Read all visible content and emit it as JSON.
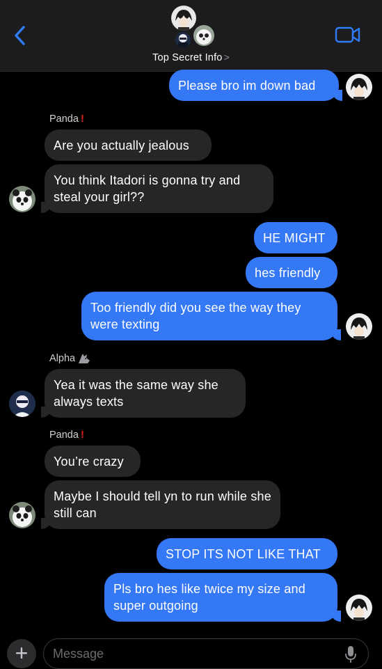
{
  "header": {
    "title": "Top Secret Info",
    "chevron": ">",
    "icons": [
      "back-chevron-icon",
      "video-camera-icon"
    ]
  },
  "messages": [
    {
      "id": "m1",
      "direction": "sent",
      "text": "Please bro im down bad"
    },
    {
      "id": "m2",
      "direction": "received",
      "sender": "Panda",
      "text": "Are you actually jealous"
    },
    {
      "id": "m3",
      "direction": "received",
      "sender": "Panda",
      "text": "You think Itadori is gonna try and steal your girl??"
    },
    {
      "id": "m4",
      "direction": "sent",
      "text": "HE MIGHT"
    },
    {
      "id": "m5",
      "direction": "sent",
      "text": "hes friendly"
    },
    {
      "id": "m6",
      "direction": "sent",
      "text": "Too friendly did you see the way they were texting"
    },
    {
      "id": "m7",
      "direction": "received",
      "sender": "Alpha",
      "text": "Yea it was the same way she always texts"
    },
    {
      "id": "m8",
      "direction": "received",
      "sender": "Panda",
      "text": "You’re crazy"
    },
    {
      "id": "m9",
      "direction": "received",
      "sender": "Panda",
      "text": "Maybe I should tell yn to run while she still can"
    },
    {
      "id": "m10",
      "direction": "sent",
      "text": "STOP ITS NOT LIKE THAT"
    },
    {
      "id": "m11",
      "direction": "sent",
      "text": "Pls bro hes like twice my size and super outgoing"
    }
  ],
  "senders": {
    "panda_1": "Panda",
    "alpha": "Alpha",
    "panda_2": "Panda"
  },
  "composer": {
    "placeholder": "Message",
    "plus": "+"
  },
  "colors": {
    "sent_bubble": "#3478f6",
    "received_bubble": "#262629",
    "header_bg": "#1c1c1e",
    "accent": "#2f7cf6"
  }
}
